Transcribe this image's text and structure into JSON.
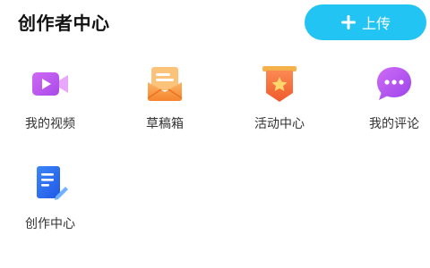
{
  "header": {
    "title": "创作者中心",
    "upload_label": "上传"
  },
  "items": [
    {
      "label": "我的视频",
      "icon": "video-camera-icon",
      "color": "#c458f0"
    },
    {
      "label": "草稿箱",
      "icon": "draft-envelope-icon",
      "color": "#f7903a"
    },
    {
      "label": "活动中心",
      "icon": "star-banner-icon",
      "color": "#f26a3a"
    },
    {
      "label": "我的评论",
      "icon": "comment-bubble-icon",
      "color": "#b451ee"
    },
    {
      "label": "创作中心",
      "icon": "document-edit-icon",
      "color": "#2f6ff0"
    }
  ],
  "colors": {
    "accent": "#21c4f2"
  }
}
